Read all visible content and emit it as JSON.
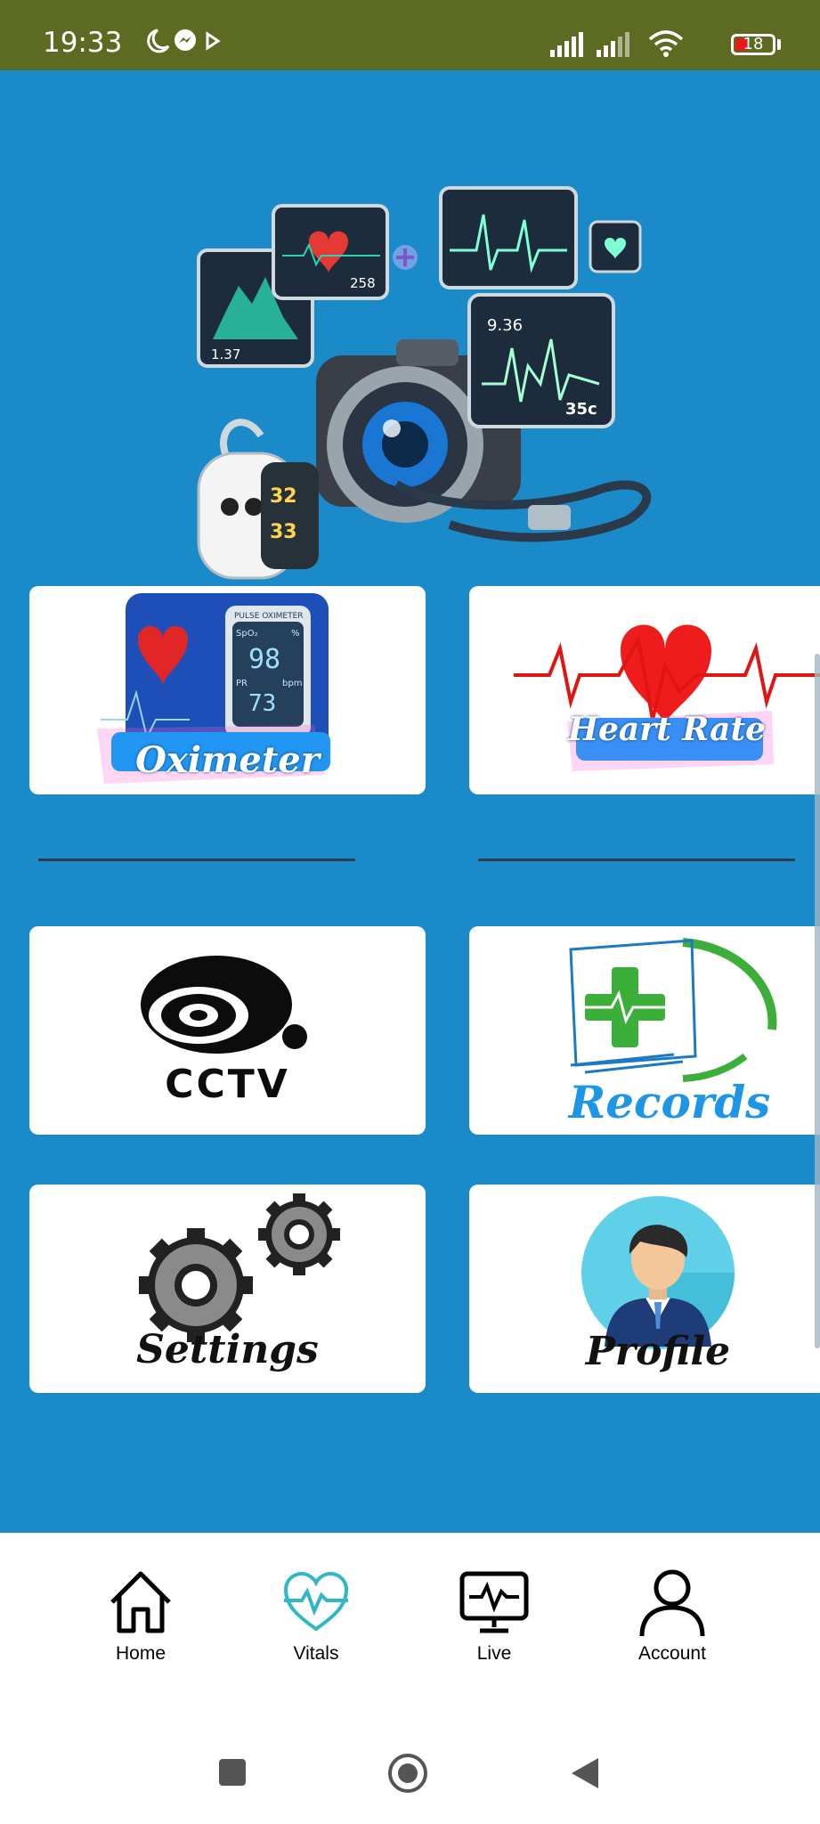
{
  "status_bar": {
    "time": "19:33",
    "battery_level": "18",
    "battery_color": "#e21b1b",
    "left_icons": [
      "moon-icon",
      "messenger-icon",
      "play-icon"
    ],
    "right_icons": [
      "signal-icon",
      "signal-icon",
      "wifi-icon",
      "battery-icon"
    ]
  },
  "theme": {
    "status_bar_bg": "#5c6b21",
    "main_bg": "#1a8ac8",
    "tile_bg": "#ffffff",
    "active_nav": "#2fb6c7"
  },
  "tiles": {
    "oximeter": {
      "label": "Oximeter",
      "device_header": "PULSE OXIMETER",
      "spo2_label": "SpO₂",
      "spo2_unit": "%",
      "spo2_value": "98",
      "pr_label": "PR",
      "pr_unit": "bpm",
      "pr_value": "73"
    },
    "heart_rate": {
      "label": "Heart Rate"
    },
    "cctv": {
      "label": "CCTV"
    },
    "records": {
      "label": "Records"
    },
    "settings": {
      "label": "Settings"
    },
    "profile": {
      "label": "Profile"
    }
  },
  "hero": {
    "monitor_values": [
      "1.37",
      "258",
      "9.36",
      "35c",
      "32",
      "33"
    ]
  },
  "nav": {
    "items": [
      {
        "label": "Home",
        "icon": "home-icon",
        "active": false
      },
      {
        "label": "Vitals",
        "icon": "heart-pulse-icon",
        "active": true
      },
      {
        "label": "Live",
        "icon": "monitor-pulse-icon",
        "active": false
      },
      {
        "label": "Account",
        "icon": "user-icon",
        "active": false
      }
    ]
  },
  "system_nav": [
    "recents-icon",
    "home-circle-icon",
    "back-icon"
  ]
}
